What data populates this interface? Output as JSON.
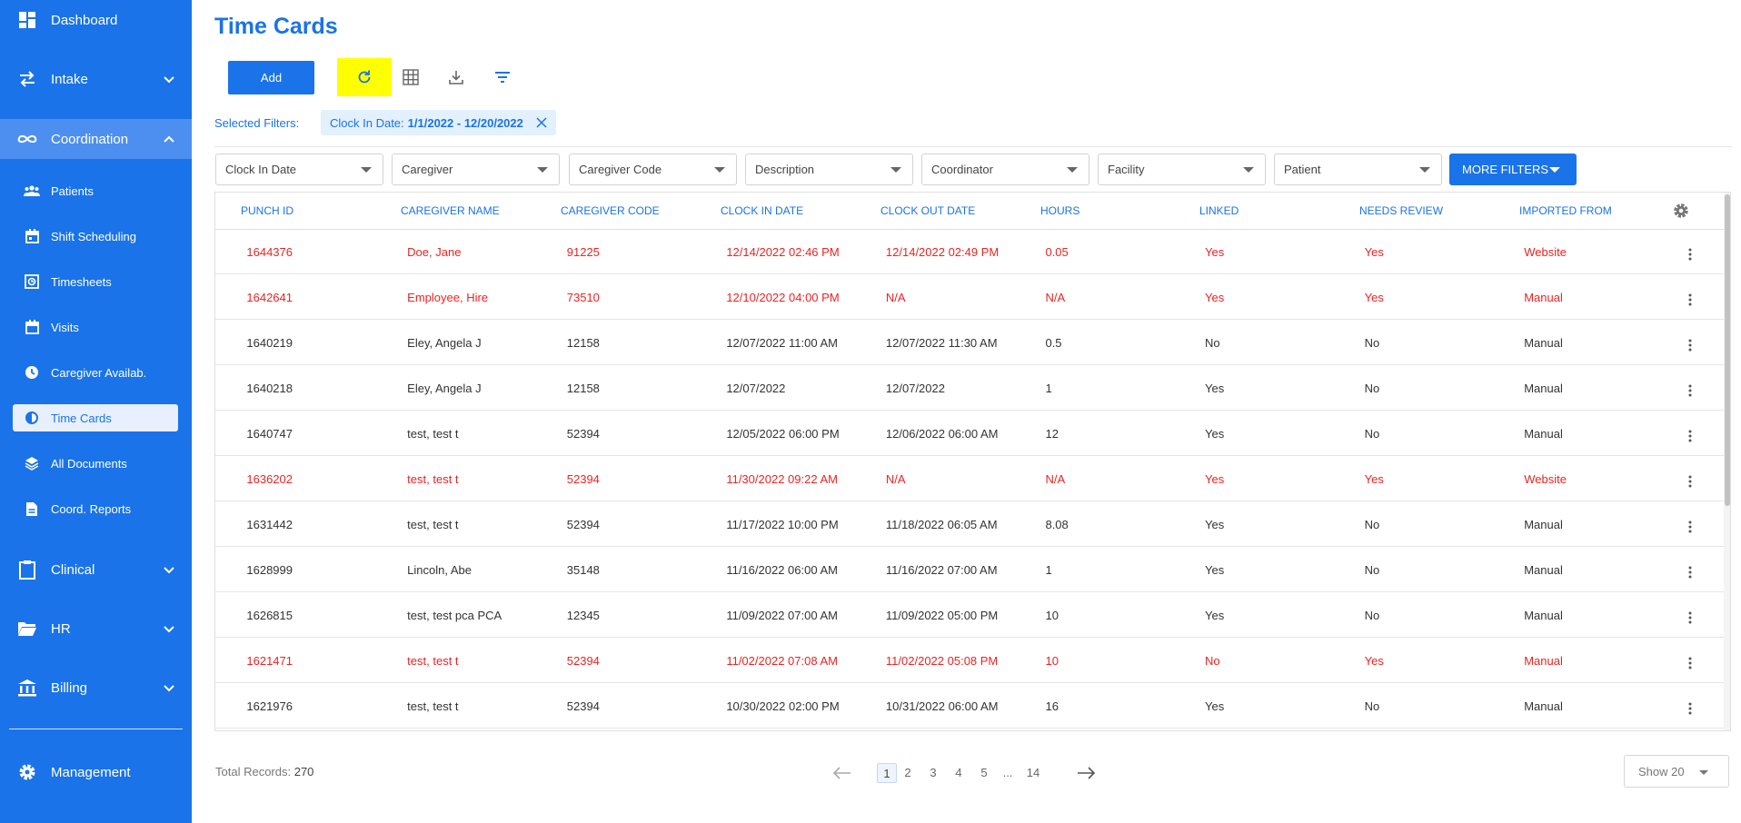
{
  "sidebar": {
    "dashboard": "Dashboard",
    "intake": "Intake",
    "coordination": "Coordination",
    "sub_items": [
      "Patients",
      "Shift Scheduling",
      "Timesheets",
      "Visits",
      "Caregiver Availab.",
      "Time Cards",
      "All Documents",
      "Coord. Reports"
    ],
    "clinical": "Clinical",
    "hr": "HR",
    "billing": "Billing",
    "management": "Management"
  },
  "header": {
    "title": "Time Cards",
    "add_label": "Add"
  },
  "filters": {
    "selected_label": "Selected Filters:",
    "chip_label": "Clock In Date:",
    "chip_value": "1/1/2022 - 12/20/2022",
    "dropdowns": [
      "Clock In Date",
      "Caregiver",
      "Caregiver Code",
      "Description",
      "Coordinator",
      "Facility",
      "Patient"
    ],
    "more_label": "MORE FILTERS"
  },
  "table": {
    "columns": [
      "Punch ID",
      "Caregiver Name",
      "Caregiver Code",
      "Clock In Date",
      "Clock Out Date",
      "Hours",
      "Linked",
      "Needs Review",
      "Imported From"
    ],
    "rows": [
      {
        "id": "1644376",
        "name": "Doe, Jane",
        "code": "91225",
        "clock_in": "12/14/2022 02:46 PM",
        "clock_out": "12/14/2022 02:49 PM",
        "hours": "0.05",
        "linked": "Yes",
        "review": "Yes",
        "imported": "Website",
        "flag": true
      },
      {
        "id": "1642641",
        "name": "Employee, Hire",
        "code": "73510",
        "clock_in": "12/10/2022 04:00 PM",
        "clock_out": "N/A",
        "hours": "N/A",
        "linked": "Yes",
        "review": "Yes",
        "imported": "Manual",
        "flag": true
      },
      {
        "id": "1640219",
        "name": "Eley, Angela J",
        "code": "12158",
        "clock_in": "12/07/2022 11:00 AM",
        "clock_out": "12/07/2022 11:30 AM",
        "hours": "0.5",
        "linked": "No",
        "review": "No",
        "imported": "Manual",
        "flag": false
      },
      {
        "id": "1640218",
        "name": "Eley, Angela J",
        "code": "12158",
        "clock_in": "12/07/2022",
        "clock_out": "12/07/2022",
        "hours": "1",
        "linked": "Yes",
        "review": "No",
        "imported": "Manual",
        "flag": false
      },
      {
        "id": "1640747",
        "name": "test, test t",
        "code": "52394",
        "clock_in": "12/05/2022 06:00 PM",
        "clock_out": "12/06/2022 06:00 AM",
        "hours": "12",
        "linked": "Yes",
        "review": "No",
        "imported": "Manual",
        "flag": false
      },
      {
        "id": "1636202",
        "name": "test, test t",
        "code": "52394",
        "clock_in": "11/30/2022 09:22 AM",
        "clock_out": "N/A",
        "hours": "N/A",
        "linked": "Yes",
        "review": "Yes",
        "imported": "Website",
        "flag": true
      },
      {
        "id": "1631442",
        "name": "test, test t",
        "code": "52394",
        "clock_in": "11/17/2022 10:00 PM",
        "clock_out": "11/18/2022 06:05 AM",
        "hours": "8.08",
        "linked": "Yes",
        "review": "No",
        "imported": "Manual",
        "flag": false
      },
      {
        "id": "1628999",
        "name": "Lincoln, Abe",
        "code": "35148",
        "clock_in": "11/16/2022 06:00 AM",
        "clock_out": "11/16/2022 07:00 AM",
        "hours": "1",
        "linked": "Yes",
        "review": "No",
        "imported": "Manual",
        "flag": false
      },
      {
        "id": "1626815",
        "name": "test, test pca PCA",
        "code": "12345",
        "clock_in": "11/09/2022 07:00 AM",
        "clock_out": "11/09/2022 05:00 PM",
        "hours": "10",
        "linked": "Yes",
        "review": "No",
        "imported": "Manual",
        "flag": false
      },
      {
        "id": "1621471",
        "name": "test, test t",
        "code": "52394",
        "clock_in": "11/02/2022 07:08 AM",
        "clock_out": "11/02/2022 05:08 PM",
        "hours": "10",
        "linked": "No",
        "review": "Yes",
        "imported": "Manual",
        "flag": true
      },
      {
        "id": "1621976",
        "name": "test, test t",
        "code": "52394",
        "clock_in": "10/30/2022 02:00 PM",
        "clock_out": "10/31/2022 06:00 AM",
        "hours": "16",
        "linked": "Yes",
        "review": "No",
        "imported": "Manual",
        "flag": false
      }
    ]
  },
  "footer": {
    "total_label": "Total Records:",
    "total_value": "270",
    "pages": [
      "1",
      "2",
      "3",
      "4",
      "5",
      "...",
      "14"
    ],
    "show_label": "Show 20"
  },
  "colors": {
    "primary": "#1a73e8",
    "flag": "#ee2222",
    "highlight": "#ffff00"
  }
}
